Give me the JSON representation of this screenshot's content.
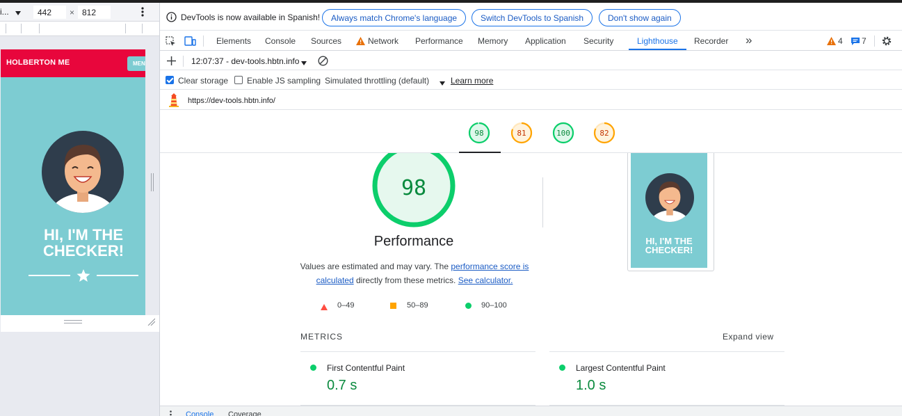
{
  "device": {
    "preset_label": "i...",
    "width": "442",
    "times": "×",
    "height": "812"
  },
  "site": {
    "logo": "HOLBERTON ME",
    "menu_label": "MENU",
    "hero_title_line1": "HI, I'M THE",
    "hero_title_line2": "CHECKER!"
  },
  "infobar": {
    "message": "DevTools is now available in Spanish!",
    "btn_match": "Always match Chrome's language",
    "btn_switch": "Switch DevTools to Spanish",
    "btn_dont_show": "Don't show again"
  },
  "tabs": {
    "elements": "Elements",
    "console": "Console",
    "sources": "Sources",
    "network": "Network",
    "performance": "Performance",
    "memory": "Memory",
    "application": "Application",
    "security": "Security",
    "lighthouse": "Lighthouse",
    "recorder": "Recorder",
    "more": "»",
    "warnings_count": "4",
    "messages_count": "7"
  },
  "lighthouse": {
    "report_label": "12:07:37 - dev-tools.hbtn.info",
    "clear_storage": "Clear storage",
    "enable_js_sampling": "Enable JS sampling",
    "throttling": "Simulated throttling (default)",
    "learn_more": "Learn more",
    "url": "https://dev-tools.hbtn.info/",
    "scores": [
      {
        "value": "98",
        "fraction": 0.98,
        "color": "#0cce6b"
      },
      {
        "value": "81",
        "fraction": 0.81,
        "color": "#ffa400"
      },
      {
        "value": "100",
        "fraction": 1.0,
        "color": "#0cce6b"
      },
      {
        "value": "82",
        "fraction": 0.82,
        "color": "#ffa400"
      }
    ],
    "perf_score": "98",
    "perf_title": "Performance",
    "desc_part1": "Values are estimated and may vary. The ",
    "desc_link1": "performance score is calculated",
    "desc_part2": " directly from these metrics. ",
    "desc_link2": "See calculator.",
    "legend_low": "0–49",
    "legend_mid": "50–89",
    "legend_high": "90–100",
    "thumb_title_line1": "HI, I'M THE",
    "thumb_title_line2": "CHECKER!",
    "metrics_heading": "METRICS",
    "expand_view": "Expand view",
    "fcp_label": "First Contentful Paint",
    "fcp_value": "0.7 s",
    "lcp_label": "Largest Contentful Paint",
    "lcp_value": "1.0 s"
  },
  "drawer": {
    "console": "Console",
    "coverage": "Coverage"
  },
  "colors": {
    "accent": "#1a73e8",
    "pass": "#0cce6b",
    "average": "#ffa400",
    "fail": "#ff4e42",
    "site_red": "#e8063c",
    "site_teal": "#7dccd2"
  }
}
